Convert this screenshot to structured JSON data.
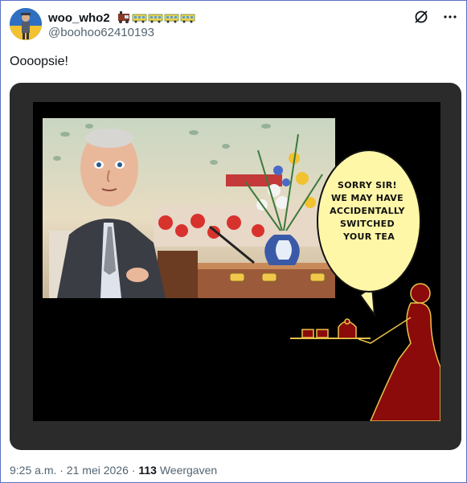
{
  "post": {
    "author": {
      "display_name": "woo_who2",
      "handle": "@boohoo62410193"
    },
    "text": "Oooopsie!",
    "image": {
      "speech_bubble": [
        "SORRY SIR!",
        "WE MAY HAVE",
        "ACCIDENTALLY",
        "SWITCHED",
        "YOUR TEA"
      ]
    },
    "footer": {
      "time": "9:25 a.m.",
      "sep1": "·",
      "date": "21 mei 2026",
      "sep2": "·",
      "views_count": "113",
      "views_label": "Weergaven"
    }
  },
  "icons": {
    "grok": "grok-icon",
    "more": "more-icon"
  },
  "colors": {
    "accent_frame": "#5b6fc4",
    "silhouette": "#8b0a0a",
    "speech_bubble": "#fff7a8"
  }
}
